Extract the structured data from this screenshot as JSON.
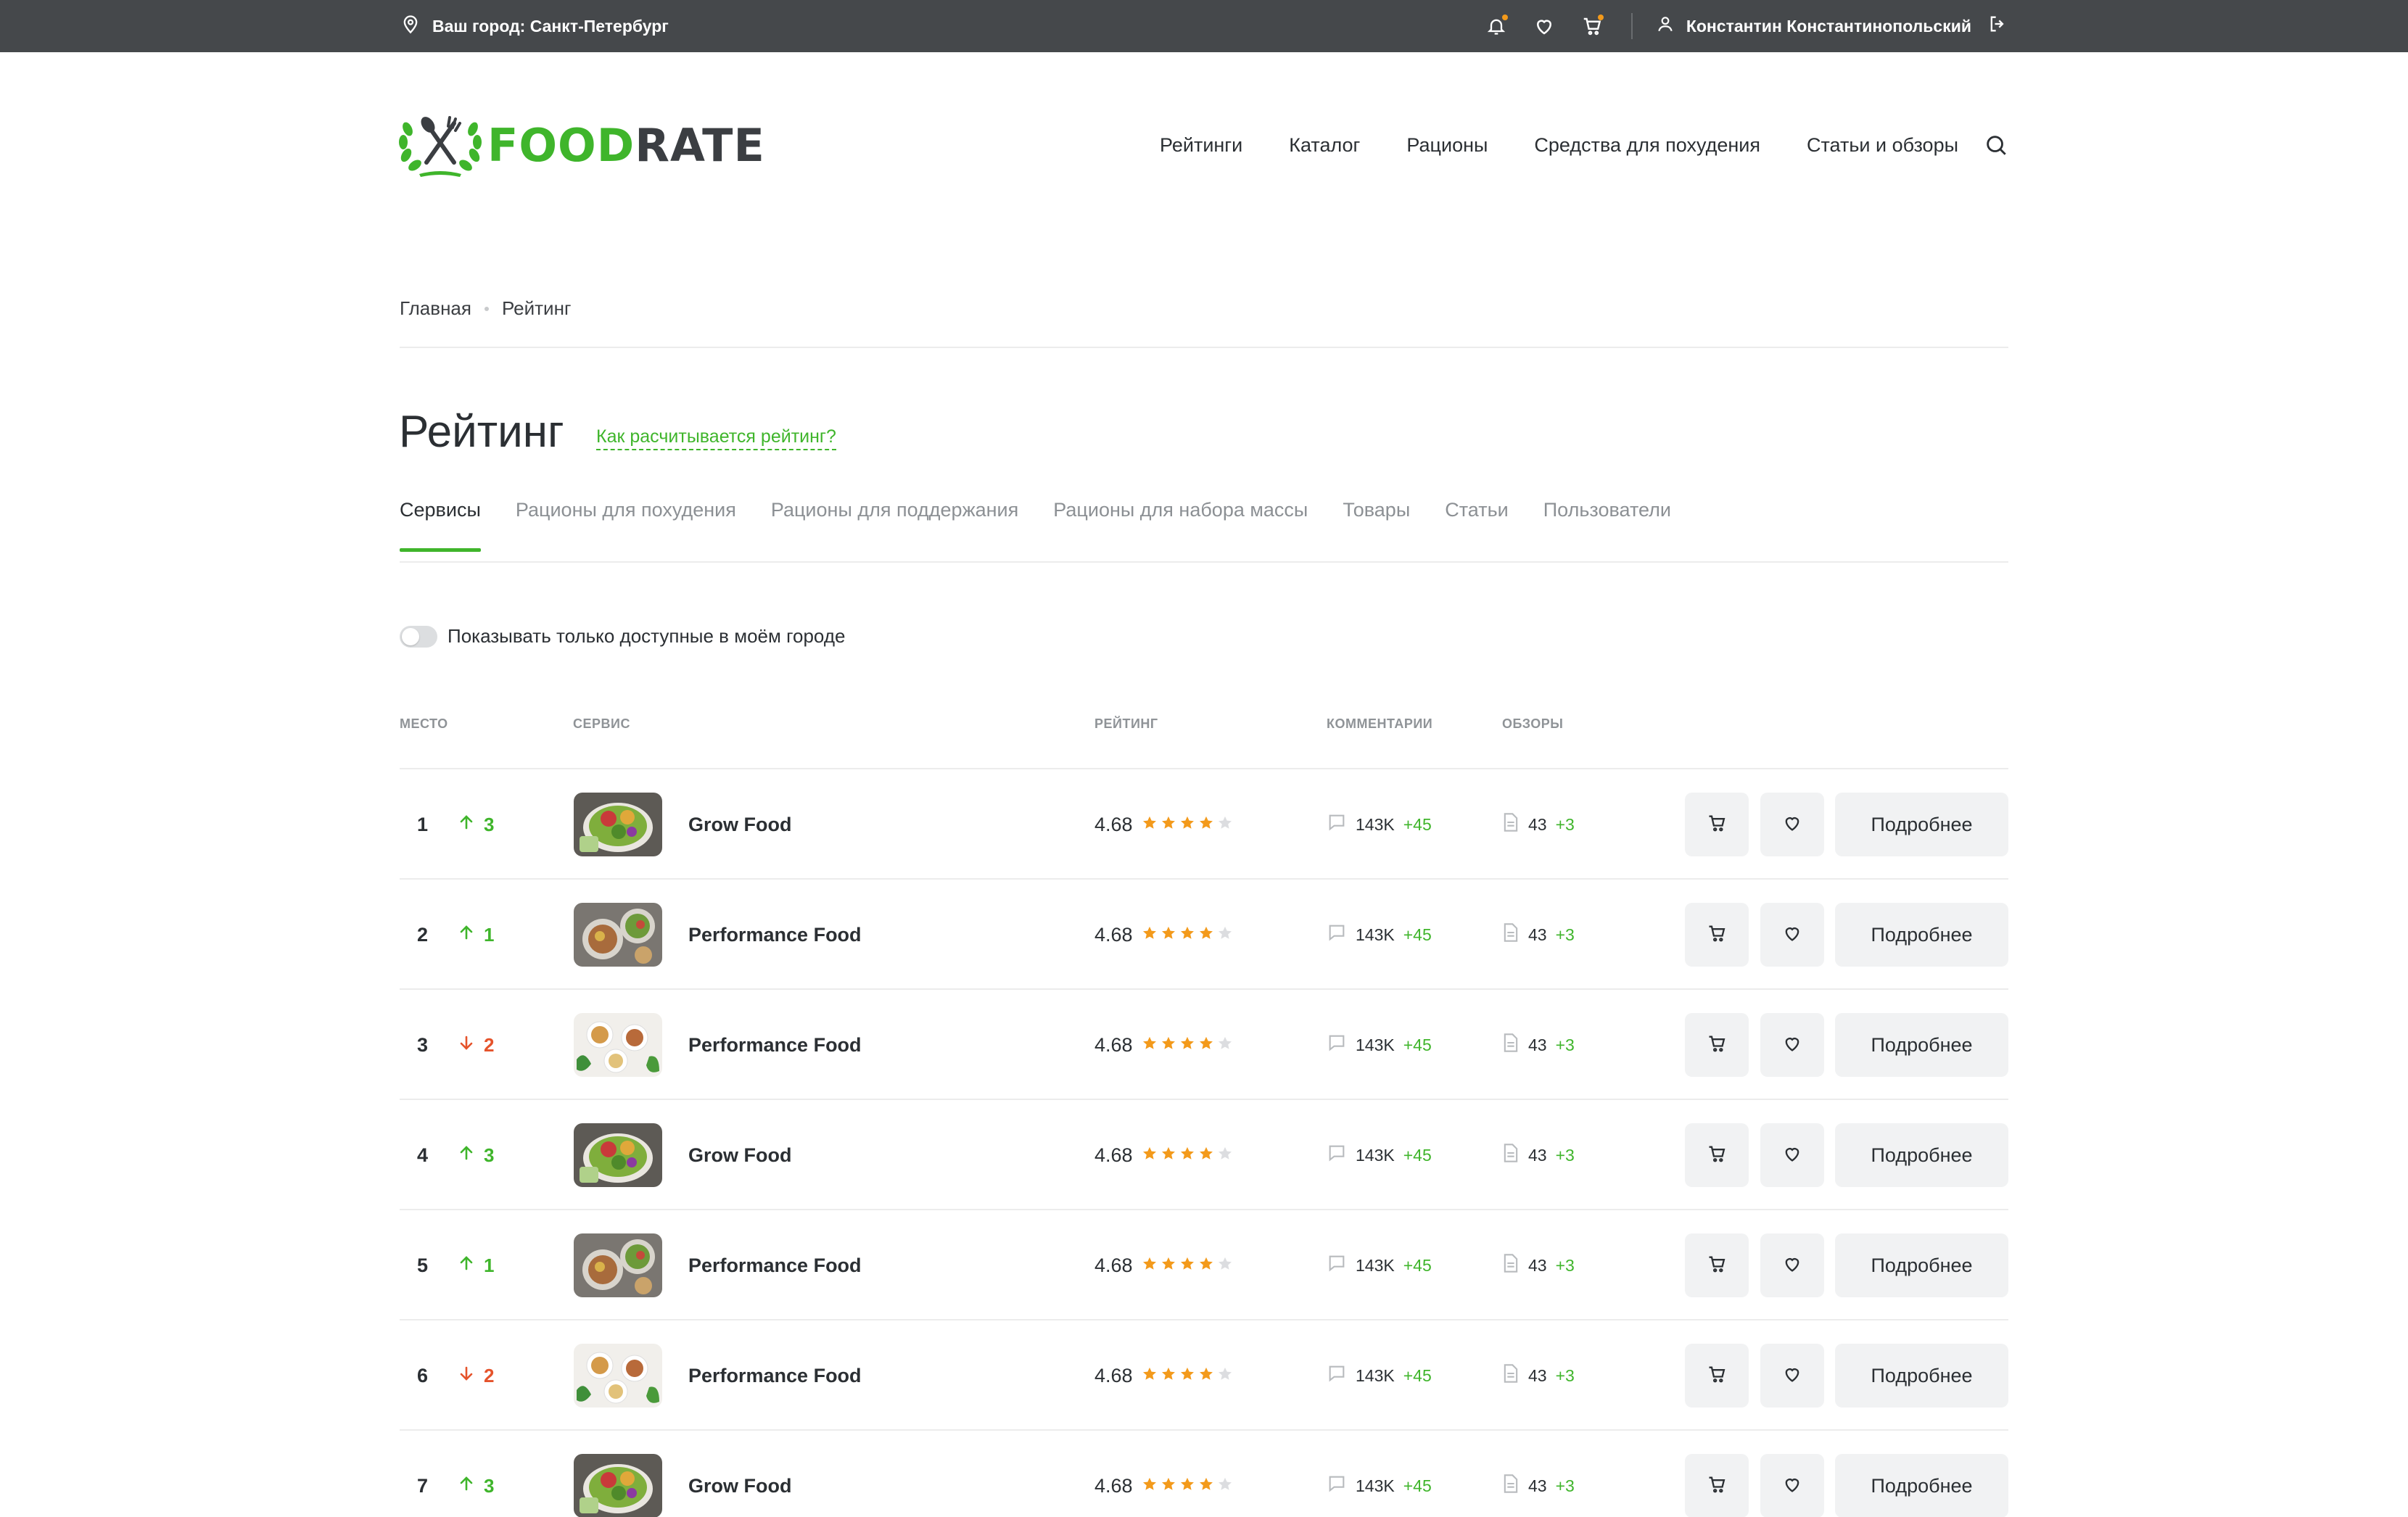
{
  "topbar": {
    "city": "Ваш город: Санкт-Петербург",
    "user_name": "Константин Константинопольский",
    "accent": "#f39a1b"
  },
  "logo": {
    "part1": "FOOD",
    "part2": "RATE",
    "brand_color": "#3fb52b"
  },
  "nav": [
    "Рейтинги",
    "Каталог",
    "Рационы",
    "Средства для похудения",
    "Статьи и обзоры"
  ],
  "breadcrumbs": [
    "Главная",
    "Рейтинг"
  ],
  "page": {
    "title": "Рейтинг",
    "how_link": "Как расчитывается рейтинг?"
  },
  "tabs": [
    {
      "label": "Сервисы",
      "active": true
    },
    {
      "label": "Рационы для похудения",
      "active": false
    },
    {
      "label": "Рационы для поддержания",
      "active": false
    },
    {
      "label": "Рационы для набора массы",
      "active": false
    },
    {
      "label": "Товары",
      "active": false
    },
    {
      "label": "Статьи",
      "active": false
    },
    {
      "label": "Пользователи",
      "active": false
    }
  ],
  "filter": {
    "label": "Показывать только доступные в моём городе",
    "enabled": false
  },
  "table": {
    "headers": {
      "place": "МЕСТО",
      "service": "СЕРВИС",
      "rating": "РЕЙТИНГ",
      "comments": "КОММЕНТАРИИ",
      "reviews": "ОБЗОРЫ"
    },
    "more_label": "Подробнее",
    "rows": [
      {
        "place": "1",
        "trend": "up",
        "change": "3",
        "name": "Grow Food",
        "rating": "4.68",
        "stars": 4,
        "comments": "143K",
        "comments_delta": "+45",
        "reviews": "43",
        "reviews_delta": "+3",
        "thumb": "bowl"
      },
      {
        "place": "2",
        "trend": "up",
        "change": "1",
        "name": "Performance Food",
        "rating": "4.68",
        "stars": 4,
        "comments": "143K",
        "comments_delta": "+45",
        "reviews": "43",
        "reviews_delta": "+3",
        "thumb": "plate"
      },
      {
        "place": "3",
        "trend": "down",
        "change": "2",
        "name": "Performance Food",
        "rating": "4.68",
        "stars": 4,
        "comments": "143K",
        "comments_delta": "+45",
        "reviews": "43",
        "reviews_delta": "+3",
        "thumb": "light"
      },
      {
        "place": "4",
        "trend": "up",
        "change": "3",
        "name": "Grow Food",
        "rating": "4.68",
        "stars": 4,
        "comments": "143K",
        "comments_delta": "+45",
        "reviews": "43",
        "reviews_delta": "+3",
        "thumb": "bowl"
      },
      {
        "place": "5",
        "trend": "up",
        "change": "1",
        "name": "Performance Food",
        "rating": "4.68",
        "stars": 4,
        "comments": "143K",
        "comments_delta": "+45",
        "reviews": "43",
        "reviews_delta": "+3",
        "thumb": "plate"
      },
      {
        "place": "6",
        "trend": "down",
        "change": "2",
        "name": "Performance Food",
        "rating": "4.68",
        "stars": 4,
        "comments": "143K",
        "comments_delta": "+45",
        "reviews": "43",
        "reviews_delta": "+3",
        "thumb": "light"
      },
      {
        "place": "7",
        "trend": "up",
        "change": "3",
        "name": "Grow Food",
        "rating": "4.68",
        "stars": 4,
        "comments": "143K",
        "comments_delta": "+45",
        "reviews": "43",
        "reviews_delta": "+3",
        "thumb": "bowl"
      }
    ]
  },
  "colors": {
    "up": "#3fb52b",
    "down": "#e5532b",
    "star": "#f39a1b",
    "star_empty": "#dcdde0"
  }
}
